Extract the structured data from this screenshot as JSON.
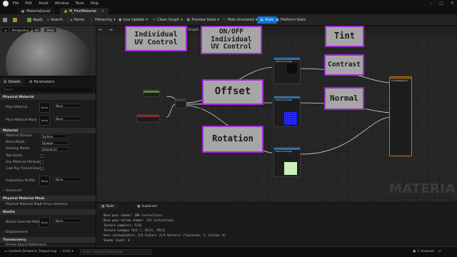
{
  "menu": [
    "File",
    "Edit",
    "Asset",
    "Window",
    "Tools",
    "Help"
  ],
  "tabs": [
    {
      "label": "MaterialLevel",
      "selected": false
    },
    {
      "label": "M_FirstMaterial",
      "selected": true
    }
  ],
  "toolbar": {
    "save": "Save",
    "browse": "Browse",
    "apply": "Apply",
    "search": "Search",
    "home": "Home",
    "hierarchy": "Hierarchy",
    "live_update": "Live Update",
    "clean_graph": "Clean Graph",
    "preview_state": "Preview State",
    "hide_unrelated": "Hide Unrelated",
    "stats": "Stats",
    "platform_stats": "Platform Stats"
  },
  "viewport": {
    "perspective": "Perspective",
    "lit": "Lit",
    "show": "Show"
  },
  "panel_tabs": [
    "Details",
    "Parameters"
  ],
  "search_placeholder": "Search",
  "details": {
    "cat_physical": "Physical Material",
    "phys_material": "Phys Material",
    "phys_material_value": "None",
    "phys_material_mask": "Phys Material Mask",
    "phys_material_mask_value": "None",
    "none_thumb": "None",
    "cat_material": "Material",
    "material_domain": "Material Domain",
    "material_domain_value": "Surface",
    "blend_mode": "Blend Mode",
    "blend_mode_value": "Opaque",
    "shading_model": "Shading Model",
    "shading_model_value": "Default Lit",
    "two_sided": "Two Sided",
    "use_material_attributes": "Use Material Attributes",
    "cast_ray_traced": "Cast Ray Traced Shad...",
    "subsurface_profile": "Subsurface Profile",
    "subsurface_value": "None",
    "advanced": "Advanced",
    "cat_phys_mask": "Physical Material Mask",
    "phys_material_map": "Physical Material Map",
    "phys_material_map_value": "8 Array elements",
    "cat_nanite": "Nanite",
    "nanite_override": "Nanite Override Mater...",
    "nanite_override_value": "None",
    "displacement": "Displacement",
    "cat_translucency": "Translucency",
    "screen_space_reflections": "Screen Space Reflections"
  },
  "graph": {
    "back": "←",
    "forward": "→",
    "label": "Graph",
    "watermark": "MATERIA"
  },
  "node_labels": {
    "texture_sample": "Texture Sample",
    "final": "M_FirstMaterial"
  },
  "callouts": {
    "individual_uv": "Individual\nUV Control",
    "onoff": "ON/OFF\nIndividual\nUV Control",
    "tint": "Tint",
    "offset": "Offset",
    "contrast": "Contrast",
    "normal": "Normal",
    "rotation": "Rotation"
  },
  "stats_tabs": [
    "Stats",
    "Substrate"
  ],
  "stats_lines": [
    "Base pass shader: 208 instructions",
    "Base pass vertex shader: 137 instructions",
    "Texture samplers: 5/16",
    "Texture Lookups (Est.): VS(3), PS(3)",
    "User interpolators: 2/4 Scalars (1/4 Vectors) (TexCoords: 2, Custom: 0)",
    "Shader Count: 4"
  ],
  "bottom": {
    "content_drawer": "Content Drawer",
    "output_log": "Output Log",
    "cmd": "Cmd",
    "console_placeholder": "Enter Console Command",
    "unsaved": "1 Unsaved",
    "revision_control": "Revision Control"
  },
  "colors": {
    "accent": "#0b72d9",
    "callout_border": "#a02bd6",
    "callout_fill": "#a6a6a6",
    "texture_header": "#2e6fa8",
    "constant_header": "#4d8c3a",
    "param_header": "#8c2a2a",
    "result_border": "#c07a1c"
  }
}
